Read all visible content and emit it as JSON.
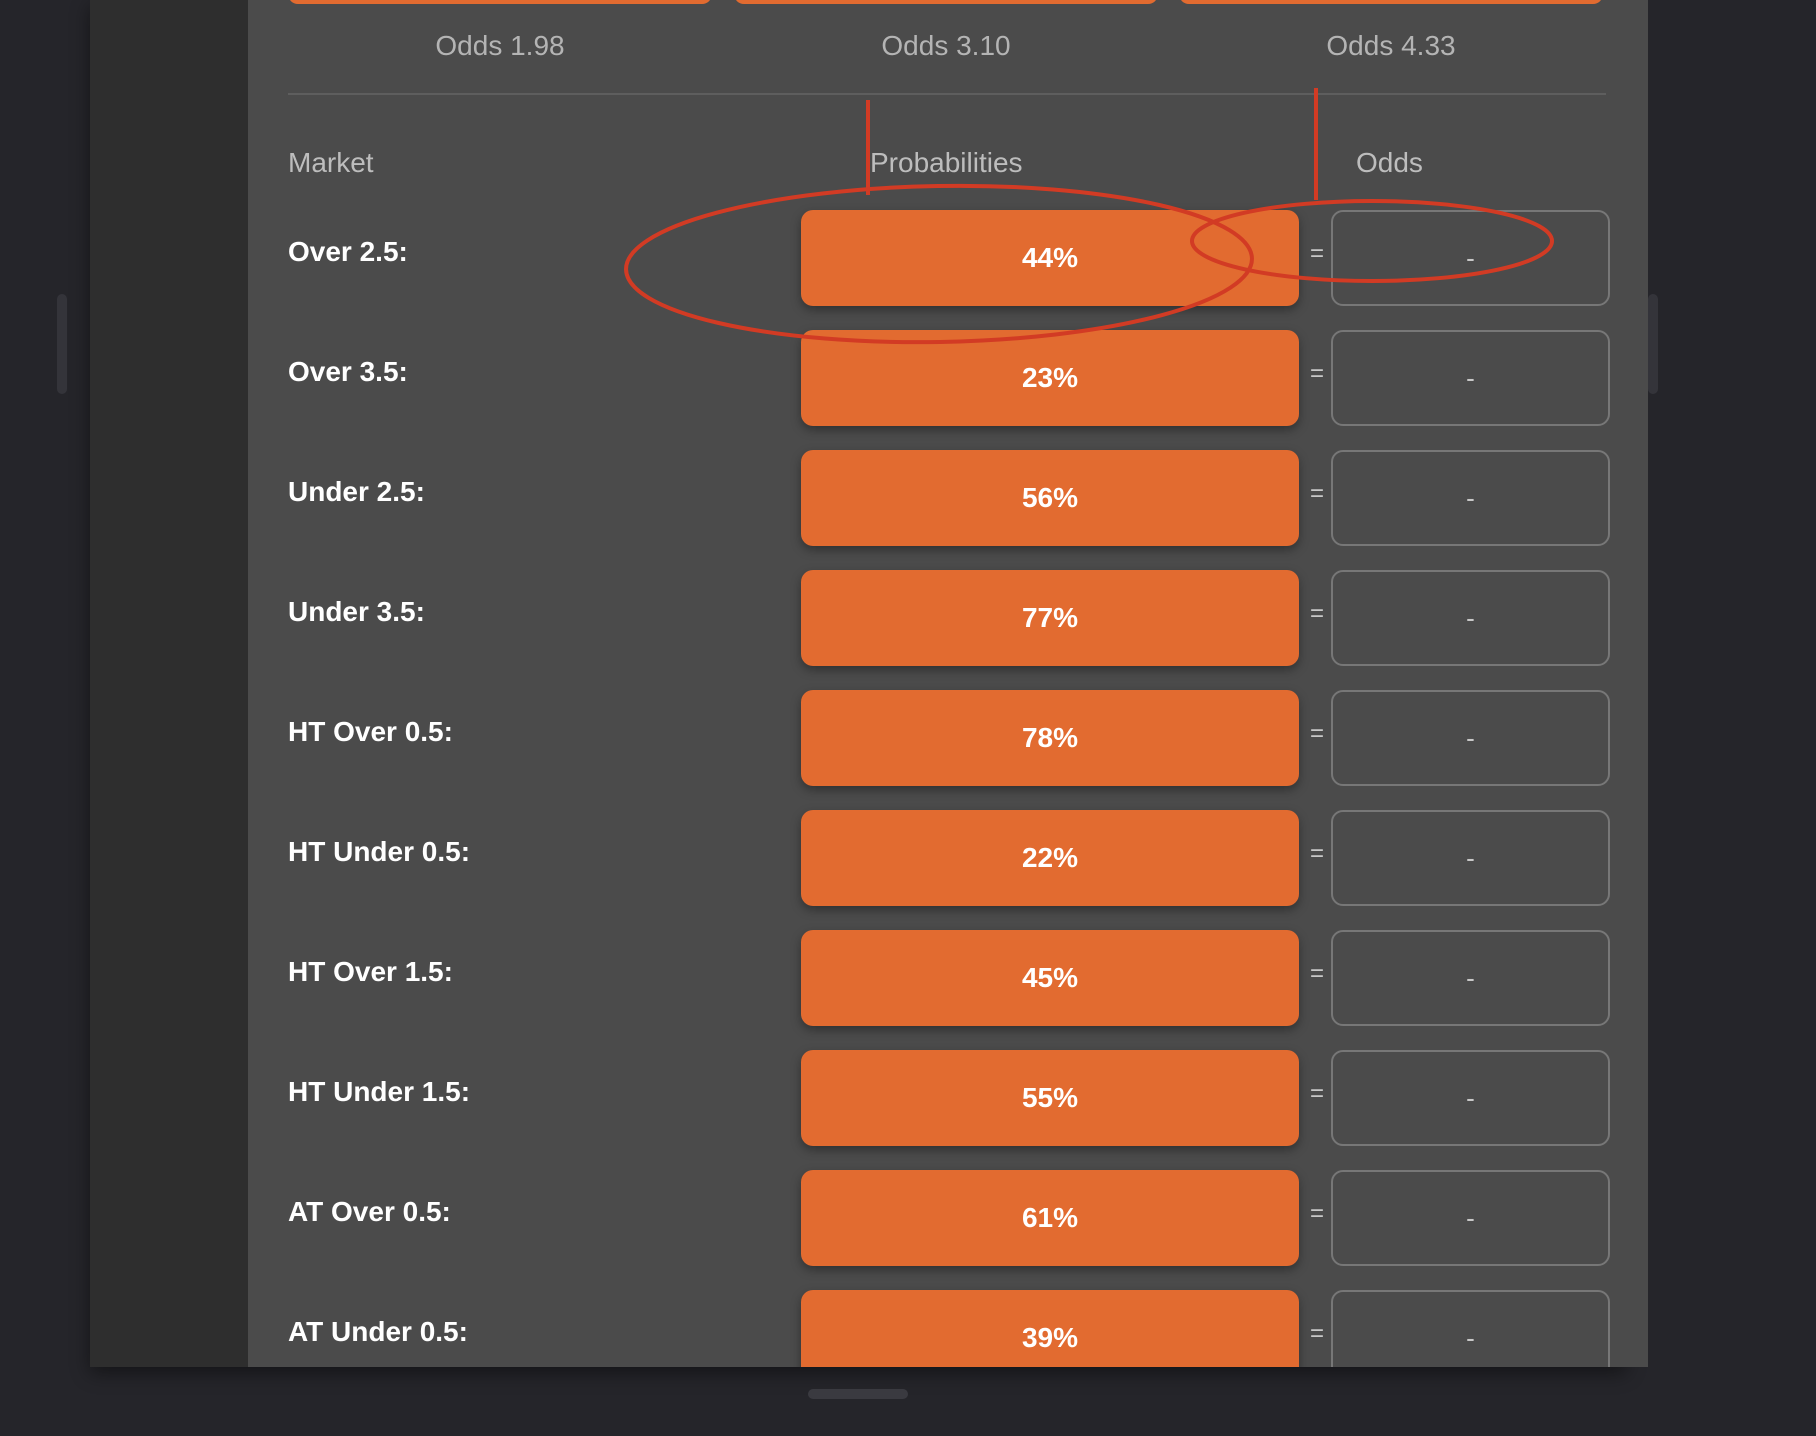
{
  "odds_header": [
    "Odds 1.98",
    "Odds 3.10",
    "Odds 4.33"
  ],
  "columns": {
    "market": "Market",
    "probabilities": "Probabilities",
    "odds": "Odds"
  },
  "equals_symbol": "=",
  "rows": [
    {
      "market": "Over 2.5:",
      "probability": "44%",
      "odds": "-"
    },
    {
      "market": "Over 3.5:",
      "probability": "23%",
      "odds": "-"
    },
    {
      "market": "Under 2.5:",
      "probability": "56%",
      "odds": "-"
    },
    {
      "market": "Under 3.5:",
      "probability": "77%",
      "odds": "-"
    },
    {
      "market": "HT Over 0.5:",
      "probability": "78%",
      "odds": "-"
    },
    {
      "market": "HT Under 0.5:",
      "probability": "22%",
      "odds": "-"
    },
    {
      "market": "HT Over 1.5:",
      "probability": "45%",
      "odds": "-"
    },
    {
      "market": "HT Under 1.5:",
      "probability": "55%",
      "odds": "-"
    },
    {
      "market": "AT Over 0.5:",
      "probability": "61%",
      "odds": "-"
    },
    {
      "market": "AT Under 0.5:",
      "probability": "39%",
      "odds": "-"
    }
  ],
  "colors": {
    "accent": "#e26b30",
    "panel": "#4b4b4b",
    "background": "#25252a",
    "annotation": "#d23b24"
  }
}
